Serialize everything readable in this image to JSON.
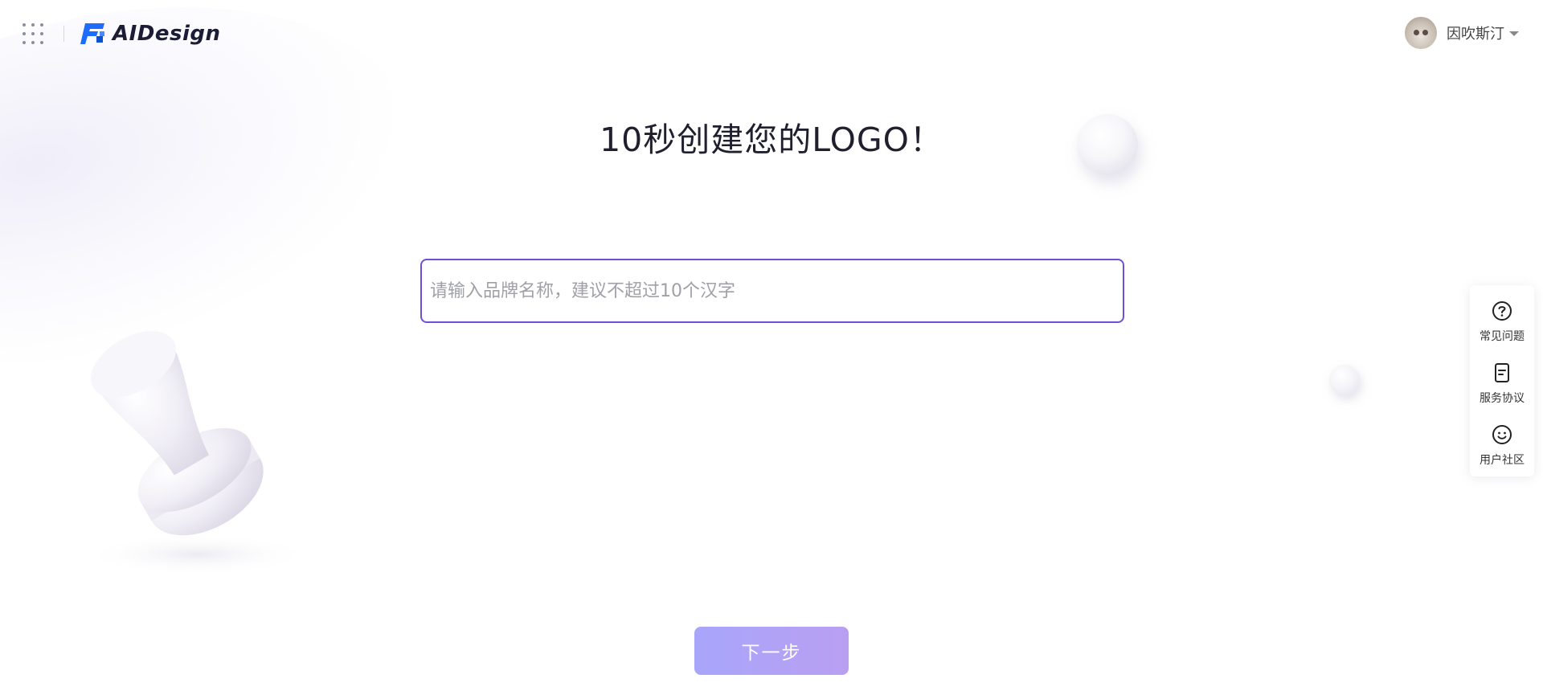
{
  "header": {
    "apps_icon": "grid-dots-icon",
    "logo_text": "AIDesign",
    "user_name": "因吹斯汀"
  },
  "main": {
    "title": "10秒创建您的LOGO！",
    "input_value": "",
    "input_placeholder": "请输入品牌名称，建议不超过10个汉字",
    "next_label": "下一步"
  },
  "side_panel": {
    "items": [
      {
        "label": "常见问题",
        "icon": "question-circle-icon"
      },
      {
        "label": "服务协议",
        "icon": "document-icon"
      },
      {
        "label": "用户社区",
        "icon": "smile-icon"
      }
    ]
  },
  "colors": {
    "accent": "#6d4fd8",
    "brand_blue": "#1e6bff",
    "button_gradient_start": "#a8a6fb",
    "button_gradient_end": "#b99ff2"
  }
}
